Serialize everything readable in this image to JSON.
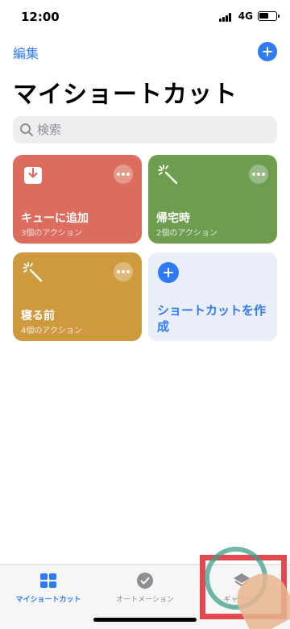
{
  "status_bar": {
    "time": "12:00",
    "network": "4G",
    "battery_level": 0.6
  },
  "nav": {
    "edit_label": "編集"
  },
  "page_title": "マイショートカット",
  "search": {
    "placeholder": "検索"
  },
  "shortcuts": [
    {
      "title": "キューに追加",
      "subtitle": "3個のアクション",
      "color": "#db6c5e",
      "icon": "download-tray-icon"
    },
    {
      "title": "帰宅時",
      "subtitle": "2個のアクション",
      "color": "#6e9d4f",
      "icon": "magic-wand-icon"
    },
    {
      "title": "寝る前",
      "subtitle": "4個のアクション",
      "color": "#cf9a3e",
      "icon": "magic-wand-icon"
    }
  ],
  "create_card": {
    "label": "ショートカットを作成"
  },
  "tabs": [
    {
      "label": "マイショートカット",
      "icon": "grid-icon",
      "active": true
    },
    {
      "label": "オートメーション",
      "icon": "clock-check-icon",
      "active": false
    },
    {
      "label": "ギャラリー",
      "icon": "layers-icon",
      "active": false
    }
  ],
  "colors": {
    "accent": "#2f7bf5",
    "highlight": "#e14b50"
  }
}
